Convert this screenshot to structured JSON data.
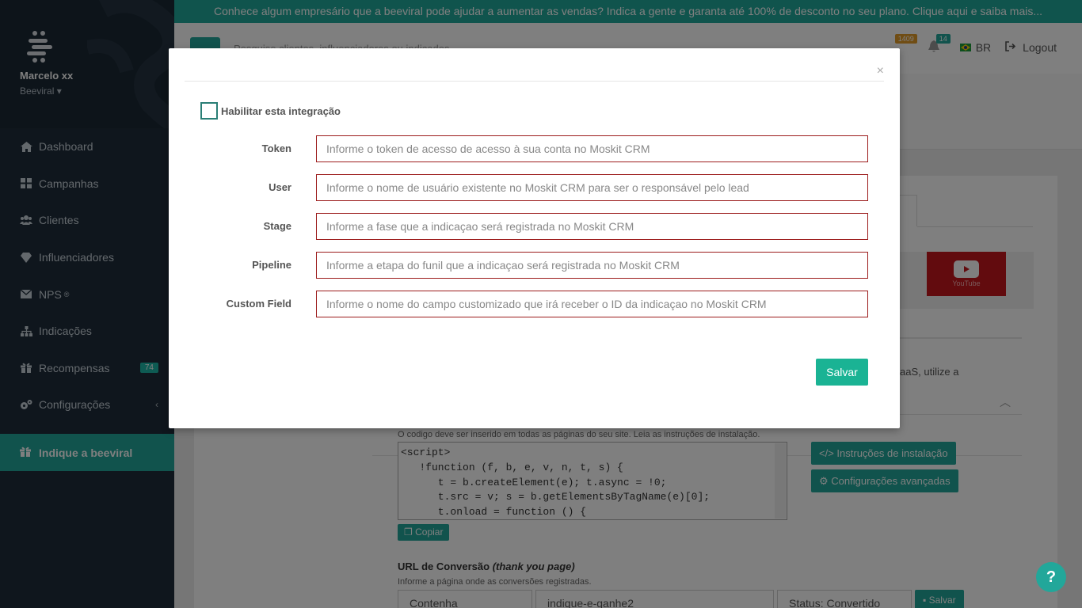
{
  "banner": "Conhece algum empresário que a beeviral pode ajudar a aumentar as vendas? Indica a gente e garanta até 100% de desconto no seu plano. Clique aqui e saiba mais...",
  "user": {
    "name": "Marcelo xx",
    "org": "Beeviral"
  },
  "nav": [
    {
      "label": "Dashboard",
      "icon": "home-icon"
    },
    {
      "label": "Campanhas",
      "icon": "grid-icon"
    },
    {
      "label": "Clientes",
      "icon": "users-icon"
    },
    {
      "label": "Influenciadores",
      "icon": "diamond-icon"
    },
    {
      "label": "NPS",
      "sup": "®",
      "icon": "envelope-icon"
    },
    {
      "label": "Indicações",
      "icon": "sitemap-icon"
    },
    {
      "label": "Recompensas",
      "badge": "74",
      "icon": "gift-icon"
    },
    {
      "label": "Configurações",
      "icon": "cogs-icon"
    }
  ],
  "nav_cta": {
    "label": "Indique a beeviral"
  },
  "header": {
    "search_placeholder": "Pesquise clientes, influenciadores ou indicados",
    "badge_one": "1409",
    "badge_two": "14",
    "lang": "BR",
    "logout": "Logout"
  },
  "page": {
    "saas_text": "aaS, utilize a",
    "youtube_label": "YouTube",
    "code_hint": "O codigo deve ser inserido em todas as páginas do seu site. Leia as instruções de instalação.",
    "code": "<script>\n   !function (f, b, e, v, n, t, s) {\n      t = b.createElement(e); t.async = !0;\n      t.src = v; s = b.getElementsByTagName(e)[0];\n      t.onload = function () {",
    "copy_label": "Copiar",
    "install_label": "Instruções de instalação",
    "advanced_label": "Configurações avançadas",
    "conv_title": "URL de Conversão",
    "conv_title_em": "(thank you page)",
    "conv_hint": "Informe a página onde as conversões registradas.",
    "select_match": "Contenha",
    "url_value": "indique-e-ganhe2",
    "status_select": "Status: Convertido",
    "save_small": "Salvar",
    "help": "?"
  },
  "modal": {
    "close": "×",
    "enable_label": "Habilitar esta integração",
    "fields": [
      {
        "label": "Token",
        "placeholder": "Informe o token de acesso de acesso à sua conta no Moskit CRM"
      },
      {
        "label": "User",
        "placeholder": "Informe o nome de usuário existente no Moskit CRM para ser o responsável pelo lead"
      },
      {
        "label": "Stage",
        "placeholder": "Informe a fase que a indicaçao será registrada no Moskit CRM"
      },
      {
        "label": "Pipeline",
        "placeholder": "Informe a etapa do funil que a indicaçao será registrada no Moskit CRM"
      },
      {
        "label": "Custom Field",
        "placeholder": "Informe o nome do campo customizado que irá receber o ID da indicaçao no Moskit CRM"
      }
    ],
    "save_label": "Salvar"
  },
  "colors": {
    "accent": "#22a79a",
    "sidebar": "#1f2d3a",
    "error_border": "#9c1c1c"
  }
}
